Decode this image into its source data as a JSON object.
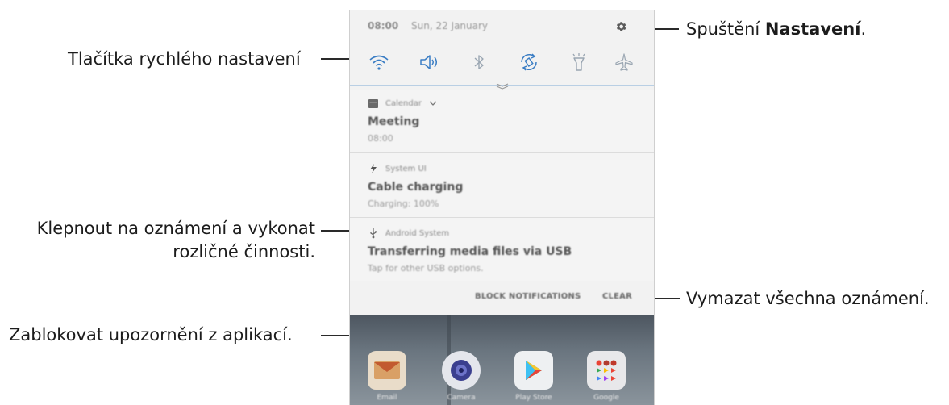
{
  "callouts": {
    "quick_settings": "Tlačítka rychlého nastavení",
    "open_settings_prefix": "Spuštění ",
    "open_settings_bold": "Nastavení",
    "open_settings_suffix": ".",
    "tap_notification_line1": "Klepnout na oznámení a vykonat",
    "tap_notification_line2": "rozličné činnosti.",
    "clear_all": "Vymazat všechna oznámení.",
    "block_notifications": "Zablokovat upozornění z aplikací."
  },
  "status_bar": {
    "time": "08:00",
    "date": "Sun, 22 January"
  },
  "quick_settings": [
    {
      "icon": "wifi-icon",
      "state": "on"
    },
    {
      "icon": "sound-icon",
      "state": "on"
    },
    {
      "icon": "bluetooth-icon",
      "state": "off"
    },
    {
      "icon": "auto-rotate-icon",
      "state": "on"
    },
    {
      "icon": "flashlight-icon",
      "state": "off"
    },
    {
      "icon": "airplane-mode-icon",
      "state": "off"
    }
  ],
  "notifications": [
    {
      "app": "Calendar",
      "title": "Meeting",
      "body": "08:00",
      "icon": "calendar-icon"
    },
    {
      "app": "System UI",
      "title": "Cable charging",
      "body": "Charging: 100%",
      "icon": "bolt-icon"
    },
    {
      "app": "Android System",
      "title": "Transferring media files via USB",
      "body": "Tap for other USB options.",
      "icon": "usb-icon"
    }
  ],
  "actions": {
    "block": "BLOCK NOTIFICATIONS",
    "clear": "CLEAR"
  },
  "home_apps": [
    {
      "name": "Email",
      "icon": "email-app-icon"
    },
    {
      "name": "Camera",
      "icon": "camera-app-icon"
    },
    {
      "name": "Play Store",
      "icon": "play-store-app-icon"
    },
    {
      "name": "Google",
      "icon": "google-folder-icon"
    }
  ],
  "colors": {
    "accent": "#3a7dc4",
    "icon_inactive": "#9aa6b2",
    "panel_bg": "#f2f2f2"
  }
}
